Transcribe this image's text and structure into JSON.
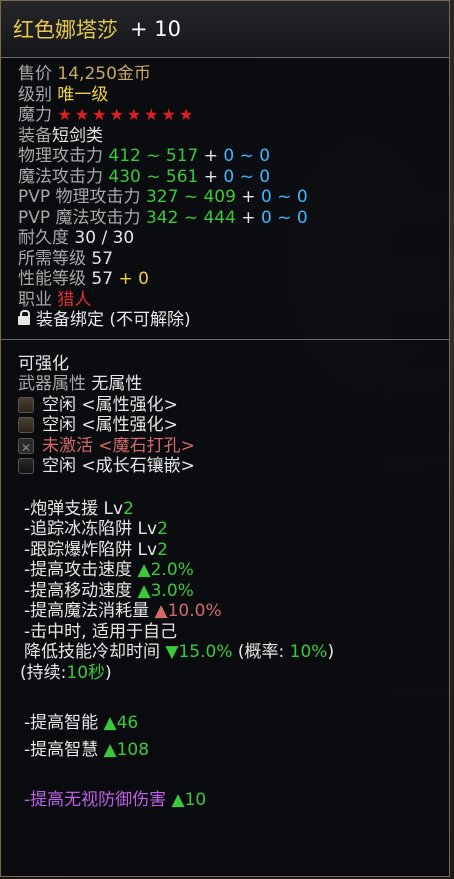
{
  "title": {
    "name": "红色娜塔莎",
    "plus": "+ 10"
  },
  "info": {
    "price_label": "售价",
    "price_value": "14,250金币",
    "grade_label": "级别",
    "grade_value": "唯一级",
    "magic_label": "魔力",
    "stars": "★★★★★★★★",
    "equip_label": "装备",
    "equip_value": "短剑类",
    "phys_label": "物理攻击力",
    "phys_range": "412 ~ 517",
    "phys_bonus_plus": " + ",
    "phys_bonus": "0 ~ 0",
    "mag_label": "魔法攻击力",
    "mag_range": "430 ~ 561",
    "mag_bonus_plus": " + ",
    "mag_bonus": "0 ~ 0",
    "pvp_phys_label": "PVP 物理攻击力",
    "pvp_phys_range": "327 ~ 409",
    "pvp_phys_plus": " + ",
    "pvp_phys_bonus": "0 ~ 0",
    "pvp_mag_label": "PVP 魔法攻击力",
    "pvp_mag_range": "342 ~ 444",
    "pvp_mag_plus": " + ",
    "pvp_mag_bonus": "0 ~ 0",
    "durability_label": "耐久度",
    "durability_value": "30 / 30",
    "req_level_label": "所需等级",
    "req_level_value": "57",
    "perf_level_label": "性能等级",
    "perf_level_value": "57",
    "perf_level_bonus": " + 0",
    "class_label": "职业",
    "class_value": "猎人",
    "bind_text": "装备绑定 (不可解除)"
  },
  "enhance": {
    "title": "可强化",
    "weapon_attr_label": "武器属性",
    "weapon_attr_value": "无属性",
    "sockets": [
      {
        "text": "空闲 <属性强化>",
        "icon": "socket-icon"
      },
      {
        "text": "空闲 <属性强化>",
        "icon": "socket-icon"
      },
      {
        "text": "未激活 <魔石打孔>",
        "icon": "locked-socket-icon"
      },
      {
        "text": "空闲 <成长石镶嵌>",
        "icon": "growth-socket-icon"
      }
    ]
  },
  "skills": [
    {
      "name": "-炮弹支援 ",
      "lv": "Lv",
      "val": "2"
    },
    {
      "name": "-追踪冰冻陷阱 ",
      "lv": "Lv",
      "val": "2"
    },
    {
      "name": "-跟踪爆炸陷阱 ",
      "lv": "Lv",
      "val": "2"
    }
  ],
  "effects": {
    "atk_speed": {
      "text": "-提高攻击速度 ",
      "val": "▲2.0%"
    },
    "move_speed": {
      "text": "-提高移动速度 ",
      "val": "▲3.0%"
    },
    "mana_cost": {
      "text": "-提高魔法消耗量 ",
      "val": "▲10.0%"
    },
    "on_hit": "-击中时, 适用于自己",
    "cooldown_text": " 降低技能冷却时间 ",
    "cooldown_val": "▼15.0%",
    "chance_open": " (概率: ",
    "chance_val": "10%",
    "chance_close": ")",
    "duration_open": "(持续:",
    "duration_val": "10秒",
    "duration_close": ")"
  },
  "stats": {
    "int": {
      "text": "-提高智能 ",
      "val": "▲46"
    },
    "wis": {
      "text": "-提高智慧 ",
      "val": "▲108"
    }
  },
  "ignore_def": {
    "text": "-提高无视防御伤害 ",
    "val": "▲10"
  }
}
